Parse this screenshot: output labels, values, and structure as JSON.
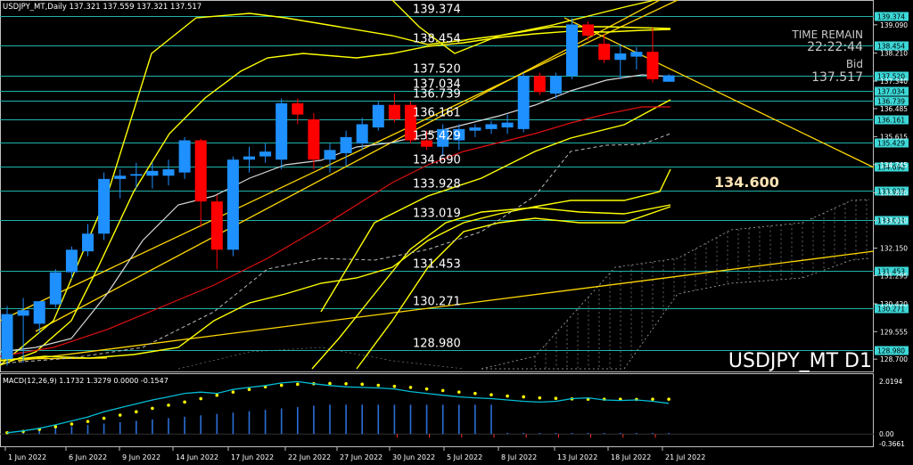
{
  "header": {
    "text": "USDJPY_MT,Daily  137.321 137.559 137.321 137.517",
    "macd_text": "MACD(12,26,9) 1.1732 1.3279 0.0000 -0.1547"
  },
  "overlay": {
    "time_remain_label": "TIME REMAIN",
    "time_remain_value": "22:22:44",
    "bid_label": "Bid",
    "bid_value": "137.517",
    "target_value": "134.600",
    "watermark": "USDJPY_MT D1"
  },
  "colors": {
    "background": "#000000",
    "bull": "#1e90ff",
    "bear": "#ff0000",
    "level_line": "#20b2aa",
    "trend_line": "#ffd700",
    "band": "#ffff00",
    "ma_white": "#d8d8d8",
    "ma_red": "#e01010",
    "macd_line": "#00bcd4",
    "macd_signal": "#ffff00",
    "price_tag_bg": "#3cd7d7",
    "target_text": "#ffe4b5"
  },
  "chart_data": {
    "type": "candlestick",
    "symbol": "USDJPY_MT",
    "timeframe": "D1",
    "ylim": [
      128.4,
      139.75
    ],
    "price_axis_ticks": [
      "139.090",
      "138.210",
      "137.340",
      "136.485",
      "135.615",
      "134.745",
      "133.870",
      "133.010",
      "132.150",
      "131.295",
      "130.420",
      "129.555",
      "128.700"
    ],
    "date_labels": [
      "1 Jun 2022",
      "6 Jun 2022",
      "9 Jun 2022",
      "14 Jun 2022",
      "17 Jun 2022",
      "22 Jun 2022",
      "27 Jun 2022",
      "30 Jun 2022",
      "5 Jul 2022",
      "8 Jul 2022",
      "13 Jul 2022",
      "18 Jul 2022",
      "21 Jul 2022"
    ],
    "levels": [
      "139.374",
      "138.454",
      "137.520",
      "137.034",
      "136.739",
      "136.161",
      "135.429",
      "134.690",
      "133.928",
      "133.019",
      "131.453",
      "130.271",
      "128.980"
    ],
    "candles": [
      {
        "o": 128.7,
        "h": 130.35,
        "l": 128.5,
        "c": 130.1
      },
      {
        "o": 130.05,
        "h": 130.6,
        "l": 128.6,
        "c": 130.22
      },
      {
        "o": 129.8,
        "h": 130.5,
        "l": 129.5,
        "c": 130.5
      },
      {
        "o": 130.4,
        "h": 131.5,
        "l": 130.3,
        "c": 131.4
      },
      {
        "o": 131.4,
        "h": 132.2,
        "l": 131.2,
        "c": 132.1
      },
      {
        "o": 132.05,
        "h": 132.9,
        "l": 131.9,
        "c": 132.6
      },
      {
        "o": 132.6,
        "h": 134.5,
        "l": 132.4,
        "c": 134.3
      },
      {
        "o": 134.3,
        "h": 134.6,
        "l": 133.7,
        "c": 134.4
      },
      {
        "o": 134.4,
        "h": 134.8,
        "l": 134.0,
        "c": 134.45
      },
      {
        "o": 134.4,
        "h": 134.8,
        "l": 134.0,
        "c": 134.55
      },
      {
        "o": 134.4,
        "h": 134.9,
        "l": 134.1,
        "c": 134.6
      },
      {
        "o": 134.5,
        "h": 135.6,
        "l": 134.3,
        "c": 135.5
      },
      {
        "o": 135.5,
        "h": 135.55,
        "l": 132.8,
        "c": 133.6
      },
      {
        "o": 133.6,
        "h": 133.8,
        "l": 131.5,
        "c": 132.1
      },
      {
        "o": 132.1,
        "h": 135.0,
        "l": 131.9,
        "c": 134.9
      },
      {
        "o": 134.9,
        "h": 135.3,
        "l": 134.5,
        "c": 135.0
      },
      {
        "o": 135.0,
        "h": 135.4,
        "l": 134.8,
        "c": 135.15
      },
      {
        "o": 134.9,
        "h": 136.8,
        "l": 134.6,
        "c": 136.65
      },
      {
        "o": 136.65,
        "h": 136.8,
        "l": 136.0,
        "c": 136.3
      },
      {
        "o": 136.15,
        "h": 136.35,
        "l": 134.6,
        "c": 134.9
      },
      {
        "o": 134.9,
        "h": 135.4,
        "l": 134.5,
        "c": 135.2
      },
      {
        "o": 135.1,
        "h": 135.8,
        "l": 134.7,
        "c": 135.6
      },
      {
        "o": 135.4,
        "h": 136.2,
        "l": 135.2,
        "c": 136.0
      },
      {
        "o": 135.9,
        "h": 136.7,
        "l": 135.8,
        "c": 136.6
      },
      {
        "o": 136.6,
        "h": 136.95,
        "l": 136.05,
        "c": 136.15
      },
      {
        "o": 136.6,
        "h": 136.7,
        "l": 135.4,
        "c": 135.5
      },
      {
        "o": 135.5,
        "h": 135.8,
        "l": 135.2,
        "c": 135.3
      },
      {
        "o": 135.3,
        "h": 136.0,
        "l": 135.0,
        "c": 135.85
      },
      {
        "o": 135.5,
        "h": 136.0,
        "l": 135.2,
        "c": 135.85
      },
      {
        "o": 135.8,
        "h": 136.0,
        "l": 135.6,
        "c": 135.9
      },
      {
        "o": 135.85,
        "h": 136.1,
        "l": 135.7,
        "c": 136.0
      },
      {
        "o": 135.9,
        "h": 136.3,
        "l": 135.7,
        "c": 136.05
      },
      {
        "o": 135.85,
        "h": 137.6,
        "l": 135.75,
        "c": 137.5
      },
      {
        "o": 137.5,
        "h": 137.6,
        "l": 136.9,
        "c": 137.0
      },
      {
        "o": 136.95,
        "h": 137.6,
        "l": 136.8,
        "c": 137.5
      },
      {
        "o": 137.5,
        "h": 139.3,
        "l": 137.4,
        "c": 139.1
      },
      {
        "o": 139.1,
        "h": 139.2,
        "l": 138.6,
        "c": 138.75
      },
      {
        "o": 138.5,
        "h": 138.8,
        "l": 137.9,
        "c": 138.0
      },
      {
        "o": 138.0,
        "h": 138.5,
        "l": 137.4,
        "c": 138.2
      },
      {
        "o": 138.1,
        "h": 138.4,
        "l": 137.7,
        "c": 138.25
      },
      {
        "o": 138.25,
        "h": 139.0,
        "l": 137.3,
        "c": 137.4
      },
      {
        "o": 137.32,
        "h": 137.56,
        "l": 137.32,
        "c": 137.52
      }
    ],
    "macd": {
      "label": "MACD(12,26,9)",
      "macd": 1.1732,
      "signal": 1.3279,
      "value3": 0.0,
      "histogram": -0.1547,
      "axis_ticks": [
        "2.0194",
        "0.00",
        "-0.3661"
      ],
      "ylim": [
        -0.3661,
        2.15
      ]
    }
  }
}
